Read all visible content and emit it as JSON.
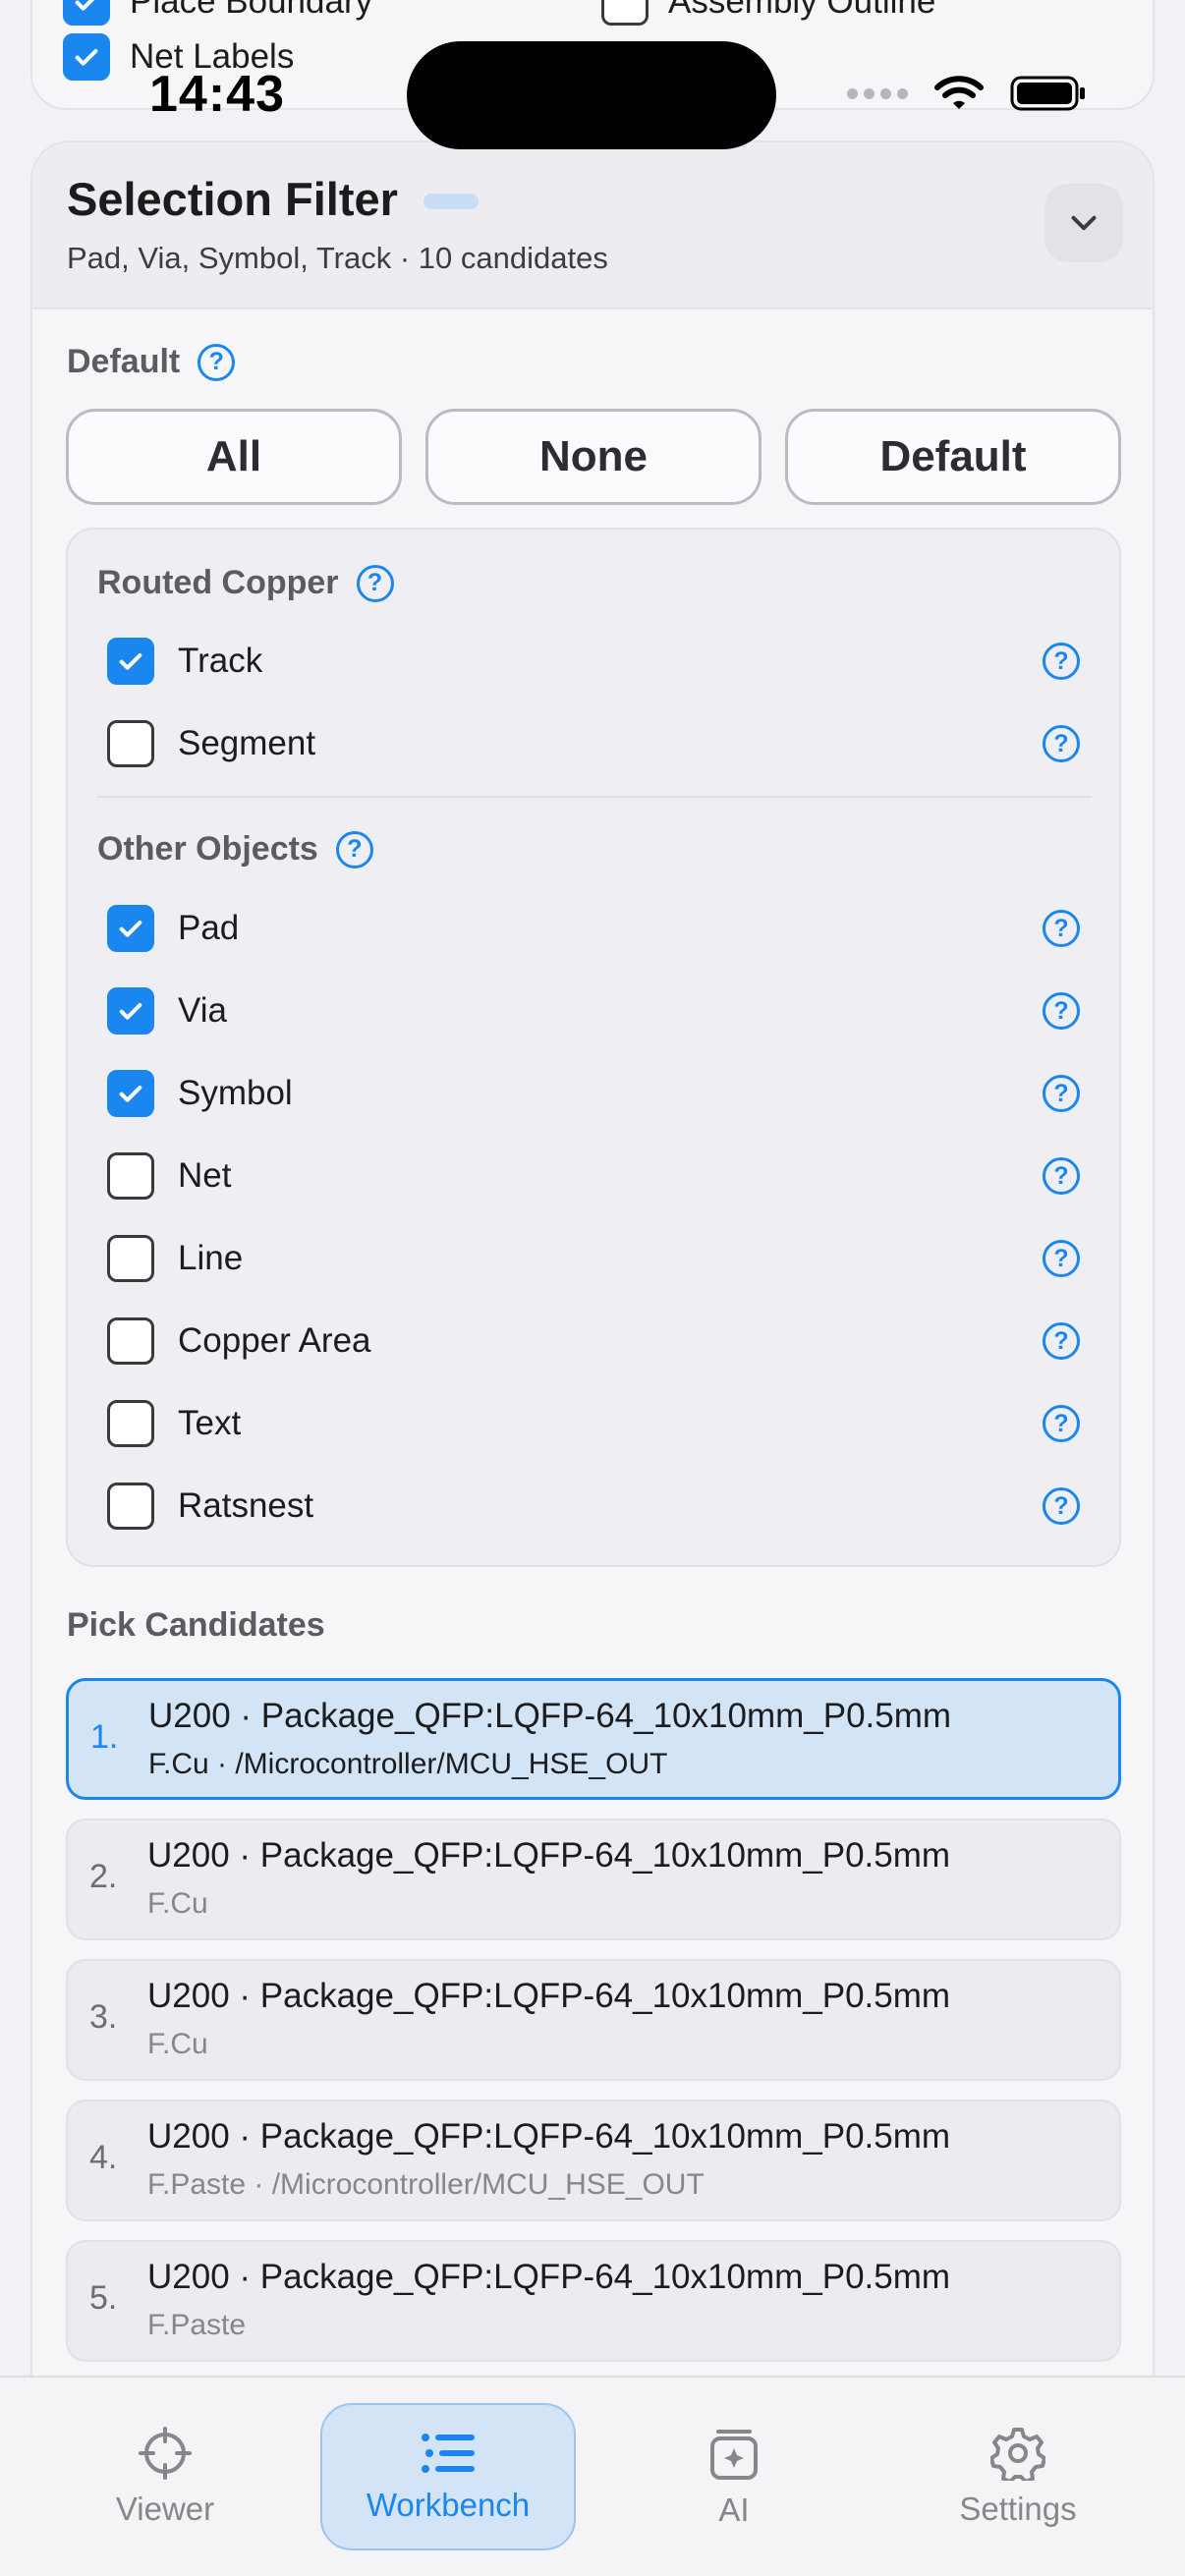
{
  "status_bar": {
    "time": "14:43"
  },
  "previous_card": {
    "items": [
      {
        "label": "Place Boundary",
        "checked": true
      },
      {
        "label": "Assembly Outline",
        "checked": false
      },
      {
        "label": "Net Labels",
        "checked": true
      }
    ]
  },
  "selection_filter": {
    "title": "Selection Filter",
    "subtitle": "Pad, Via, Symbol, Track · 10 candidates",
    "default_label": "Default",
    "buttons": {
      "all": "All",
      "none": "None",
      "default": "Default"
    },
    "routed_copper": {
      "label": "Routed Copper",
      "items": [
        {
          "label": "Track",
          "checked": true
        },
        {
          "label": "Segment",
          "checked": false
        }
      ]
    },
    "other_objects": {
      "label": "Other Objects",
      "items": [
        {
          "label": "Pad",
          "checked": true
        },
        {
          "label": "Via",
          "checked": true
        },
        {
          "label": "Symbol",
          "checked": true
        },
        {
          "label": "Net",
          "checked": false
        },
        {
          "label": "Line",
          "checked": false
        },
        {
          "label": "Copper Area",
          "checked": false
        },
        {
          "label": "Text",
          "checked": false
        },
        {
          "label": "Ratsnest",
          "checked": false
        }
      ]
    },
    "pick_candidates": {
      "label": "Pick Candidates",
      "items": [
        {
          "num": "1.",
          "title": "U200 · Package_QFP:LQFP-64_10x10mm_P0.5mm",
          "sub": "F.Cu · /Microcontroller/MCU_HSE_OUT",
          "selected": true
        },
        {
          "num": "2.",
          "title": "U200 · Package_QFP:LQFP-64_10x10mm_P0.5mm",
          "sub": "F.Cu",
          "selected": false
        },
        {
          "num": "3.",
          "title": "U200 · Package_QFP:LQFP-64_10x10mm_P0.5mm",
          "sub": "F.Cu",
          "selected": false
        },
        {
          "num": "4.",
          "title": "U200 · Package_QFP:LQFP-64_10x10mm_P0.5mm",
          "sub": "F.Paste · /Microcontroller/MCU_HSE_OUT",
          "selected": false
        },
        {
          "num": "5.",
          "title": "U200 · Package_QFP:LQFP-64_10x10mm_P0.5mm",
          "sub": "F.Paste",
          "selected": false
        }
      ]
    }
  },
  "tabbar": {
    "tabs": [
      {
        "label": "Viewer",
        "icon": "crosshair-icon",
        "active": false
      },
      {
        "label": "Workbench",
        "icon": "list-icon",
        "active": true
      },
      {
        "label": "AI",
        "icon": "ai-sparkle-icon",
        "active": false
      },
      {
        "label": "Settings",
        "icon": "gear-icon",
        "active": false
      }
    ]
  },
  "colors": {
    "accent": "#1a86f0",
    "selected_bg": "#d3e4f7"
  }
}
